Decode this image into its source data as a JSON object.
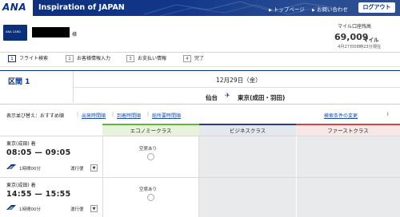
{
  "header": {
    "logo": "ANA",
    "tagline": "Inspiration of JAPAN",
    "links": [
      "トップページ",
      "お問い合わせ"
    ],
    "logout": "ログアウト"
  },
  "member": {
    "card_label": "ANA CARD",
    "honorific": "様",
    "mile_label": "マイル口座残高",
    "mile_value": "69,009",
    "mile_unit": "マイル",
    "mile_date": "4月27日08時23分現在"
  },
  "steps": [
    {
      "num": "1",
      "label": "フライト検索",
      "active": true
    },
    {
      "num": "2",
      "label": "お客様情報入力",
      "active": false
    },
    {
      "num": "3",
      "label": "お支払い情報",
      "active": false
    },
    {
      "num": "4",
      "label": "完了",
      "active": false
    }
  ],
  "segment": {
    "title": "区間 1",
    "date": "12月29日（金）",
    "from": "仙台",
    "to": "東京(成田・羽田)"
  },
  "sort": {
    "label": "表示並び替え：おすすめ順",
    "options": [
      "出発時間順",
      "到着時間順",
      "総所要時間順"
    ],
    "change_search": "検索条件の変更"
  },
  "classes": {
    "economy": "エコノミークラス",
    "business": "ビジネスクラス",
    "first": "ファーストクラス"
  },
  "flights": [
    {
      "airport": "東京(成田) 着",
      "times": "08:05 — 09:05",
      "duration": "1時間00分",
      "notes": "運行便",
      "economy_status": "空席あり"
    },
    {
      "airport": "東京(成田) 着",
      "times": "14:55 — 15:55",
      "duration": "1時間00分",
      "notes": "運行便",
      "economy_status": "空席あり"
    }
  ],
  "colors": {
    "brand": "#0b2f84",
    "economy": "#67b43d",
    "business": "#2a3f7a",
    "first": "#c84945"
  }
}
